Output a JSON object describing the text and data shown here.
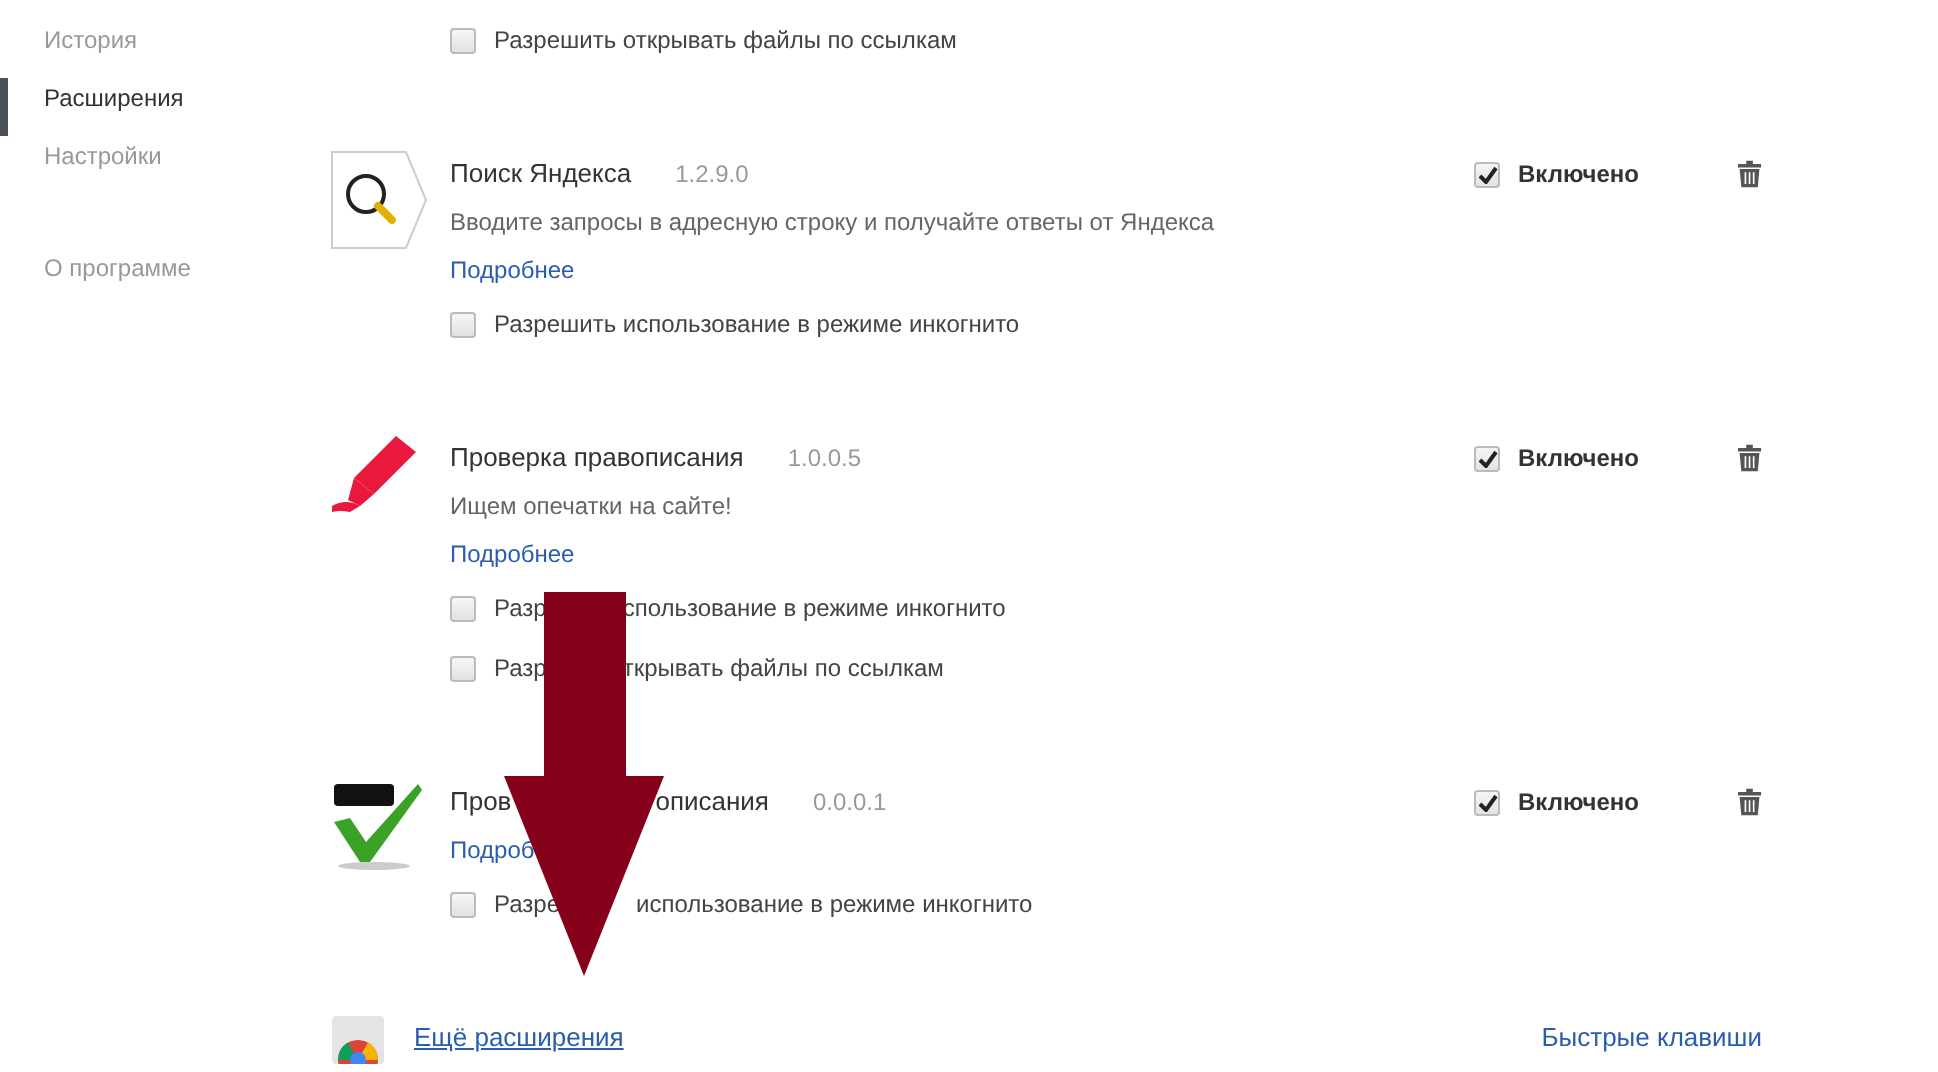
{
  "sidebar": {
    "items": [
      {
        "label": "История",
        "selected": false
      },
      {
        "label": "Расширения",
        "selected": true
      },
      {
        "label": "Настройки",
        "selected": false
      },
      {
        "label": "О программе",
        "selected": false
      }
    ]
  },
  "top_options": [
    {
      "parts": [
        "Разрешить открывать файлы по ссылкам"
      ],
      "checked": false
    }
  ],
  "extensions": [
    {
      "name_parts": [
        "Поиск Яндекса"
      ],
      "version": "1.2.9.0",
      "description": "Вводите запросы в адресную строку и получайте ответы от Яндекса",
      "details_link": "Подробнее",
      "options": [
        {
          "parts": [
            "Разрешить использование в режиме инкогнито"
          ],
          "checked": false
        }
      ],
      "enabled_label": "Включено",
      "enabled": true
    },
    {
      "name_parts": [
        "Проверка правописания"
      ],
      "version": "1.0.0.5",
      "description": "Ищем опечатки на сайте!",
      "details_link": "Подробнее",
      "options": [
        {
          "parts": [
            "Разр",
            "спользование в режиме инкогнито"
          ],
          "checked": false
        },
        {
          "parts": [
            "Разр",
            "ткрывать файлы по ссылкам"
          ],
          "checked": false
        }
      ],
      "enabled_label": "Включено",
      "enabled": true
    },
    {
      "name_parts": [
        "Пров",
        "описания"
      ],
      "version": "0.0.0.1",
      "details_link": "Подроб",
      "options": [
        {
          "parts": [
            "Разре",
            "использование в режиме инкогнито"
          ],
          "checked": false
        }
      ],
      "enabled_label": "Включено",
      "enabled": true
    }
  ],
  "footer": {
    "more_link": "Ещё расширения",
    "shortcuts_link": "Быстрые клавиши"
  }
}
